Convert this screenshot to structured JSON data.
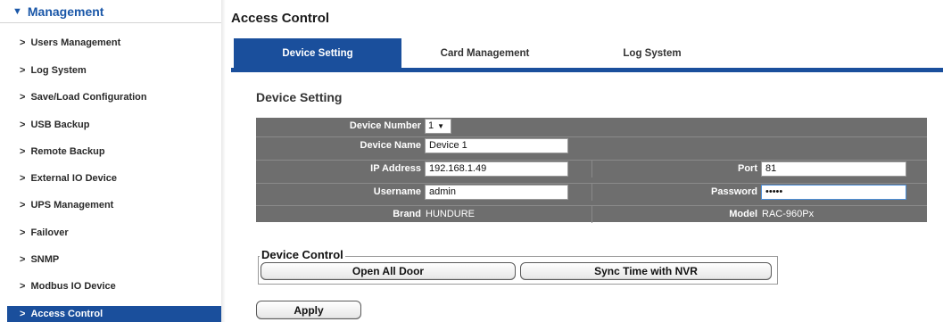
{
  "sidebar": {
    "heading": "Management",
    "items": [
      {
        "label": "Users Management"
      },
      {
        "label": "Log System"
      },
      {
        "label": "Save/Load Configuration"
      },
      {
        "label": "USB Backup"
      },
      {
        "label": "Remote Backup"
      },
      {
        "label": "External IO Device"
      },
      {
        "label": "UPS Management"
      },
      {
        "label": "Failover"
      },
      {
        "label": "SNMP"
      },
      {
        "label": "Modbus IO Device"
      },
      {
        "label": "Access Control",
        "active": true
      }
    ]
  },
  "main": {
    "title": "Access Control",
    "tabs": [
      {
        "label": "Device Setting",
        "active": true
      },
      {
        "label": "Card Management"
      },
      {
        "label": "Log System"
      }
    ],
    "section_title": "Device Setting",
    "form": {
      "device_number": {
        "label": "Device Number",
        "value": "1"
      },
      "device_name": {
        "label": "Device Name",
        "value": "Device 1"
      },
      "ip_address": {
        "label": "IP Address",
        "value": "192.168.1.49"
      },
      "port": {
        "label": "Port",
        "value": "81"
      },
      "username": {
        "label": "Username",
        "value": "admin"
      },
      "password": {
        "label": "Password",
        "value": "•••••"
      },
      "brand": {
        "label": "Brand",
        "value": "HUNDURE"
      },
      "model": {
        "label": "Model",
        "value": "RAC-960Px"
      }
    },
    "device_control": {
      "legend": "Device Control",
      "open_all_door": "Open All Door",
      "sync_time": "Sync Time with NVR"
    },
    "apply_label": "Apply"
  },
  "colors": {
    "accent": "#1a4f9c",
    "table_bg": "#6e6e6e"
  },
  "icons": {
    "collapse": "triangle-down-icon",
    "item": "chevron-right-icon",
    "dropdown": "dropdown-arrow-icon"
  }
}
